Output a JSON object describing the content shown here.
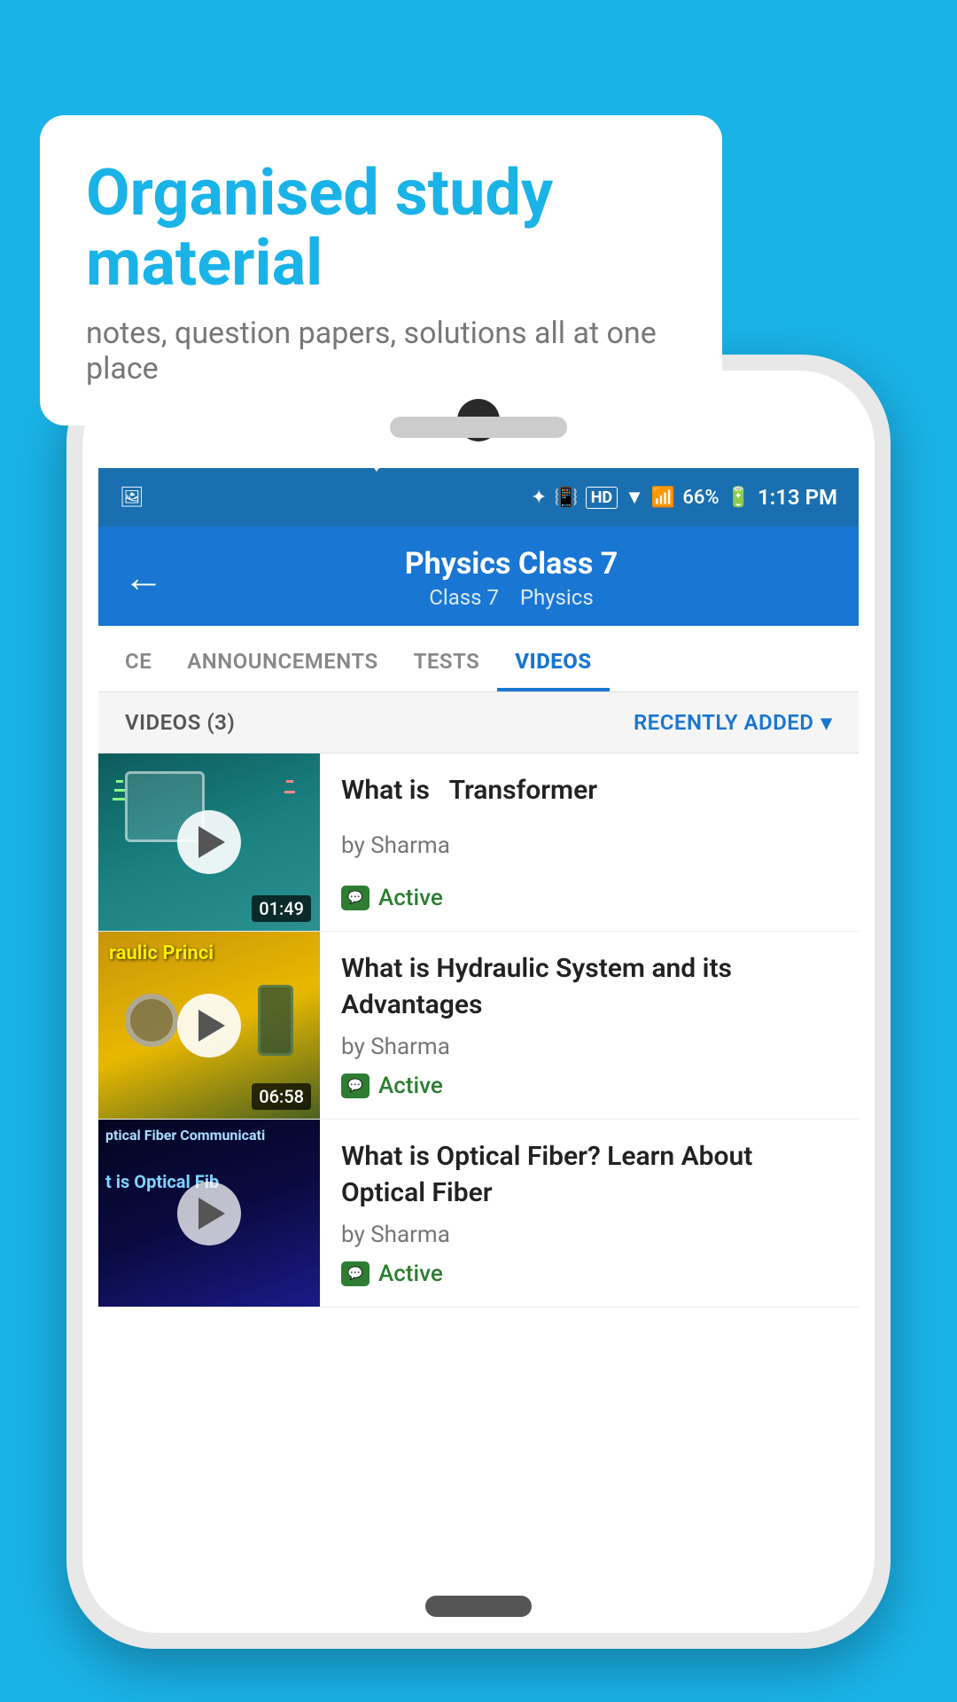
{
  "background_color": "#1ab3e8",
  "speech_bubble": {
    "heading": "Organised study material",
    "subtext": "notes, question papers, solutions all at one place"
  },
  "status_bar": {
    "time": "1:13 PM",
    "battery": "66%",
    "signal_text": "HD"
  },
  "nav_bar": {
    "back_label": "←",
    "title": "Physics Class 7",
    "subtitle_class": "Class 7",
    "subtitle_sep": "›",
    "subtitle_subject": "Physics"
  },
  "tabs": [
    {
      "id": "ce",
      "label": "CE",
      "active": false
    },
    {
      "id": "announcements",
      "label": "ANNOUNCEMENTS",
      "active": false
    },
    {
      "id": "tests",
      "label": "TESTS",
      "active": false
    },
    {
      "id": "videos",
      "label": "VIDEOS",
      "active": true
    }
  ],
  "videos_section": {
    "header_count": "VIDEOS (3)",
    "sort_label": "RECENTLY ADDED",
    "sort_icon": "▾"
  },
  "videos": [
    {
      "id": 1,
      "title": "What is  Transformer",
      "author": "by Sharma",
      "status": "Active",
      "duration": "01:49",
      "thumb_class": "thumb1",
      "thumb_label": ""
    },
    {
      "id": 2,
      "title": "What is Hydraulic System and its Advantages",
      "author": "by Sharma",
      "status": "Active",
      "duration": "06:58",
      "thumb_class": "thumb2",
      "thumb_label": "raulic Princi"
    },
    {
      "id": 3,
      "title": "What is Optical Fiber? Learn About Optical Fiber",
      "author": "by Sharma",
      "status": "Active",
      "duration": "",
      "thumb_class": "thumb3",
      "thumb_label": "ptical Fiber Communicati\nt is Optical Fib"
    }
  ]
}
